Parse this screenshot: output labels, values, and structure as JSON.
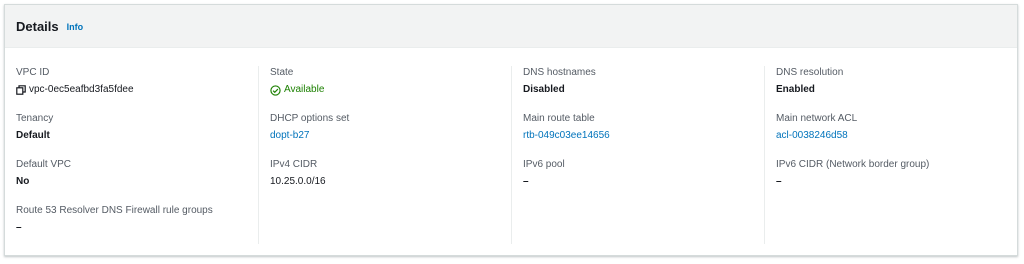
{
  "header": {
    "title": "Details",
    "info_label": "Info"
  },
  "columns": [
    {
      "fields": [
        {
          "label": "VPC ID",
          "value": "vpc-0ec5eafbd3fa5fdee"
        },
        {
          "label": "Tenancy",
          "value": "Default"
        },
        {
          "label": "Default VPC",
          "value": "No"
        },
        {
          "label": "Route 53 Resolver DNS Firewall rule groups",
          "value": "–"
        }
      ]
    },
    {
      "fields": [
        {
          "label": "State",
          "value": "Available"
        },
        {
          "label": "DHCP options set",
          "value": "dopt-b27"
        },
        {
          "label": "IPv4 CIDR",
          "value": "10.25.0.0/16"
        }
      ]
    },
    {
      "fields": [
        {
          "label": "DNS hostnames",
          "value": "Disabled"
        },
        {
          "label": "Main route table",
          "value": "rtb-049c03ee14656"
        },
        {
          "label": "IPv6 pool",
          "value": "–"
        }
      ]
    },
    {
      "fields": [
        {
          "label": "DNS resolution",
          "value": "Enabled"
        },
        {
          "label": "Main network ACL",
          "value": "acl-0038246d58"
        },
        {
          "label": "IPv6 CIDR (Network border group)",
          "value": "–"
        }
      ]
    }
  ],
  "colors": {
    "link": "#0073bb",
    "success": "#1d8102",
    "header_bg": "#f2f3f3",
    "label": "#545b64"
  },
  "icons": {
    "copy": "copy-icon",
    "status_ok": "check-circle-icon"
  }
}
